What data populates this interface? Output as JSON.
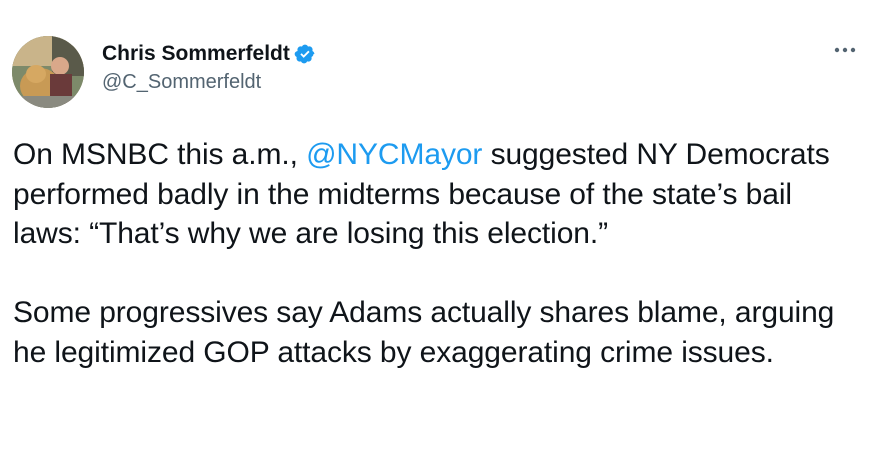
{
  "author": {
    "display_name": "Chris Sommerfeldt",
    "handle": "@C_Sommerfeldt",
    "verified": true,
    "avatar_icon": "profile-photo-icon"
  },
  "menu": {
    "icon": "more-options-icon"
  },
  "tweet": {
    "paragraph1": {
      "before_mention": "On MSNBC this a.m., ",
      "mention": "@NYCMayor",
      "after_mention": " suggested NY Democrats performed badly in the midterms because of the state’s bail laws: “That’s why we are losing this election.”"
    },
    "paragraph2": "Some progressives say Adams actually shares blame, arguing he legitimized GOP attacks by exaggerating crime issues."
  },
  "colors": {
    "text": "#0f1419",
    "secondary": "#536471",
    "accent": "#1d9bf0",
    "background": "#ffffff"
  }
}
